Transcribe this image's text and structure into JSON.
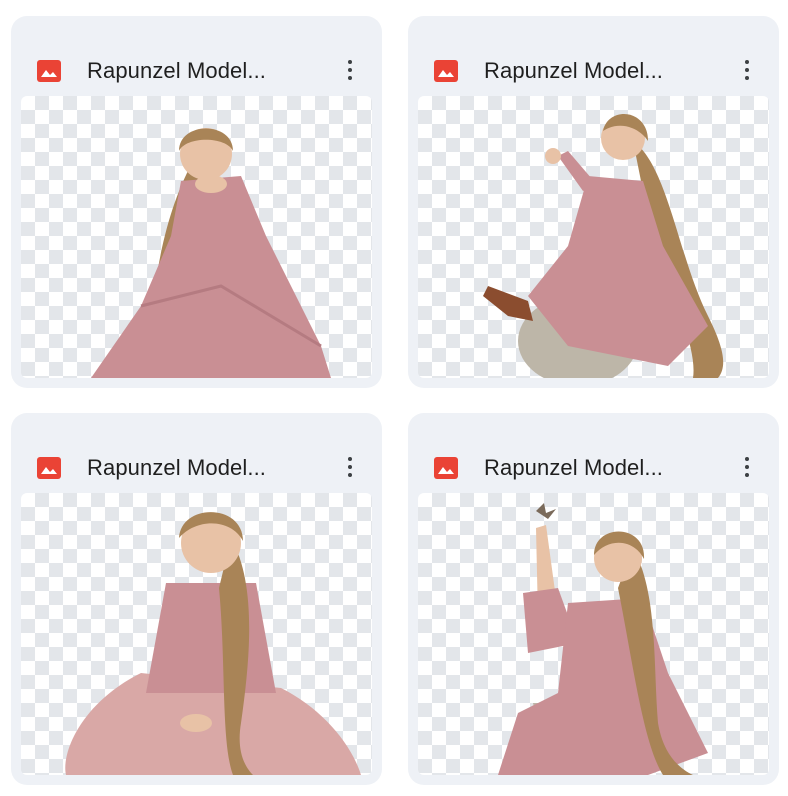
{
  "files": [
    {
      "name": "Rapunzel Model...",
      "icon": "image-file-icon"
    },
    {
      "name": "Rapunzel Model...",
      "icon": "image-file-icon"
    },
    {
      "name": "Rapunzel Model...",
      "icon": "image-file-icon"
    },
    {
      "name": "Rapunzel Model...",
      "icon": "image-file-icon"
    }
  ],
  "colors": {
    "card_bg": "#eef1f6",
    "icon_red": "#ea4335",
    "text": "#1f1f1f",
    "dress_pink": "#c98f94",
    "hair_gold": "#a98457",
    "stone_gray": "#a6a29c",
    "skin": "#e8c2a6"
  }
}
